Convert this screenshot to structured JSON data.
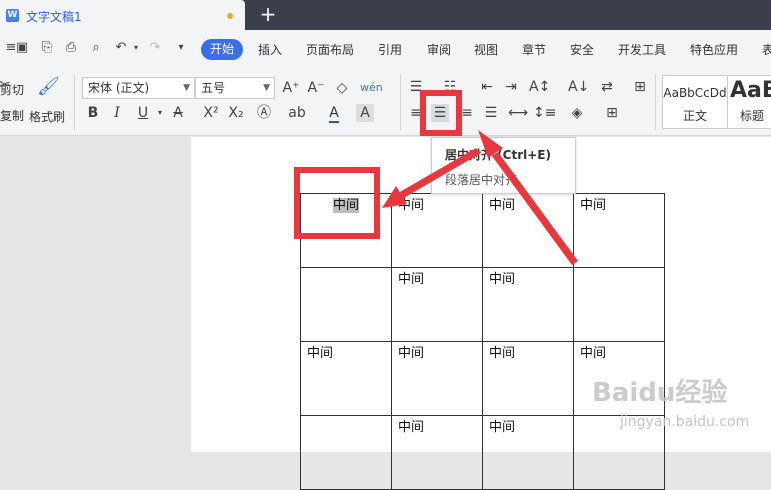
{
  "titlebar": {
    "doc_tab": "文字文稿1",
    "new_tab": "+"
  },
  "menu": {
    "items": [
      "开始",
      "插入",
      "页面布局",
      "引用",
      "审阅",
      "视图",
      "章节",
      "安全",
      "开发工具",
      "特色应用",
      "表"
    ],
    "active": "开始"
  },
  "ribbon": {
    "cut": "剪切",
    "copy": "复制",
    "format_painter": "格式刷",
    "font_name": "宋体 (正文)",
    "font_size": "五号",
    "style_normal_sample": "AaBbCcDd",
    "style_normal": "正文",
    "style_heading_sample": "AaB",
    "style_heading": "标题"
  },
  "tooltip": {
    "title": "居中对齐 (Ctrl+E)",
    "desc": "段落居中对齐"
  },
  "table": {
    "rows": [
      [
        "中间",
        "中间",
        "中间",
        "中间"
      ],
      [
        "",
        "中间",
        "中间",
        ""
      ],
      [
        "中间",
        "中间",
        "中间",
        "中间"
      ],
      [
        "",
        "中间",
        "中间",
        ""
      ]
    ]
  },
  "watermark": {
    "main": "Baidu经验",
    "sub": "jingyan.baidu.com"
  },
  "colors": {
    "accent": "#3b6fe8",
    "annotation": "#e8383d",
    "titlebar": "#3a3f4b"
  }
}
